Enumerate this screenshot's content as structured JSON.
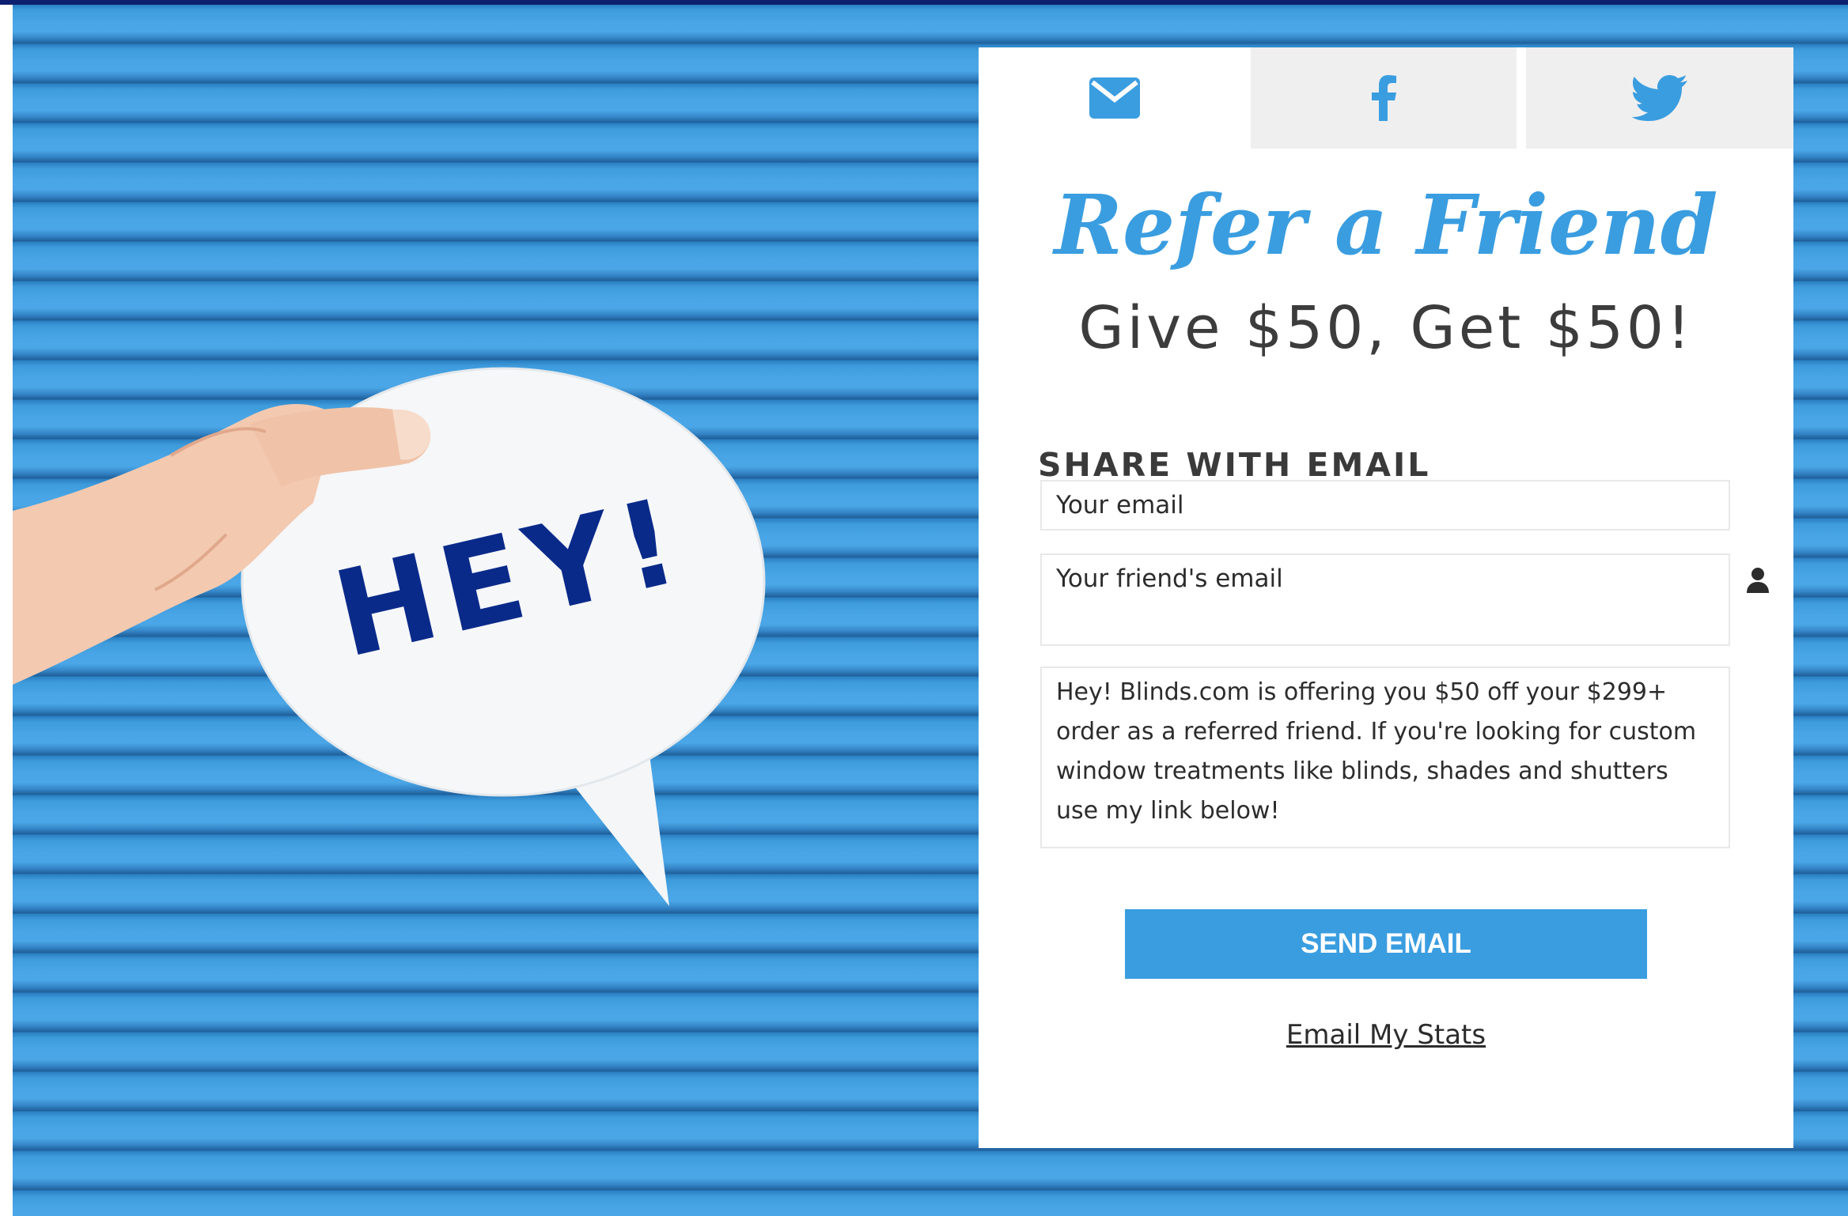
{
  "tabs": [
    {
      "id": "email",
      "icon": "envelope-icon",
      "active": true
    },
    {
      "id": "facebook",
      "icon": "facebook-icon",
      "active": false
    },
    {
      "id": "twitter",
      "icon": "twitter-icon",
      "active": false
    }
  ],
  "hero": {
    "bubble_text": "HEY!"
  },
  "card": {
    "title": "Refer a Friend",
    "subtitle": "Give $50, Get $50!",
    "section_heading": "SHARE WITH EMAIL",
    "your_email_placeholder": "Your email",
    "friend_email_placeholder": "Your friend's email",
    "message": "Hey! Blinds.com is offering you $50 off your $299+ order as a referred friend. If you're looking for custom window treatments like blinds, shades and shutters use my link below!",
    "send_button_label": "SEND EMAIL",
    "stats_link_label": "Email My Stats"
  },
  "colors": {
    "accent": "#3a9de0",
    "top_bar": "#0d1f6e",
    "stripe_light": "#4aa6e6",
    "stripe_dark": "#1f5f99",
    "bubble_text": "#0a2a8a"
  }
}
